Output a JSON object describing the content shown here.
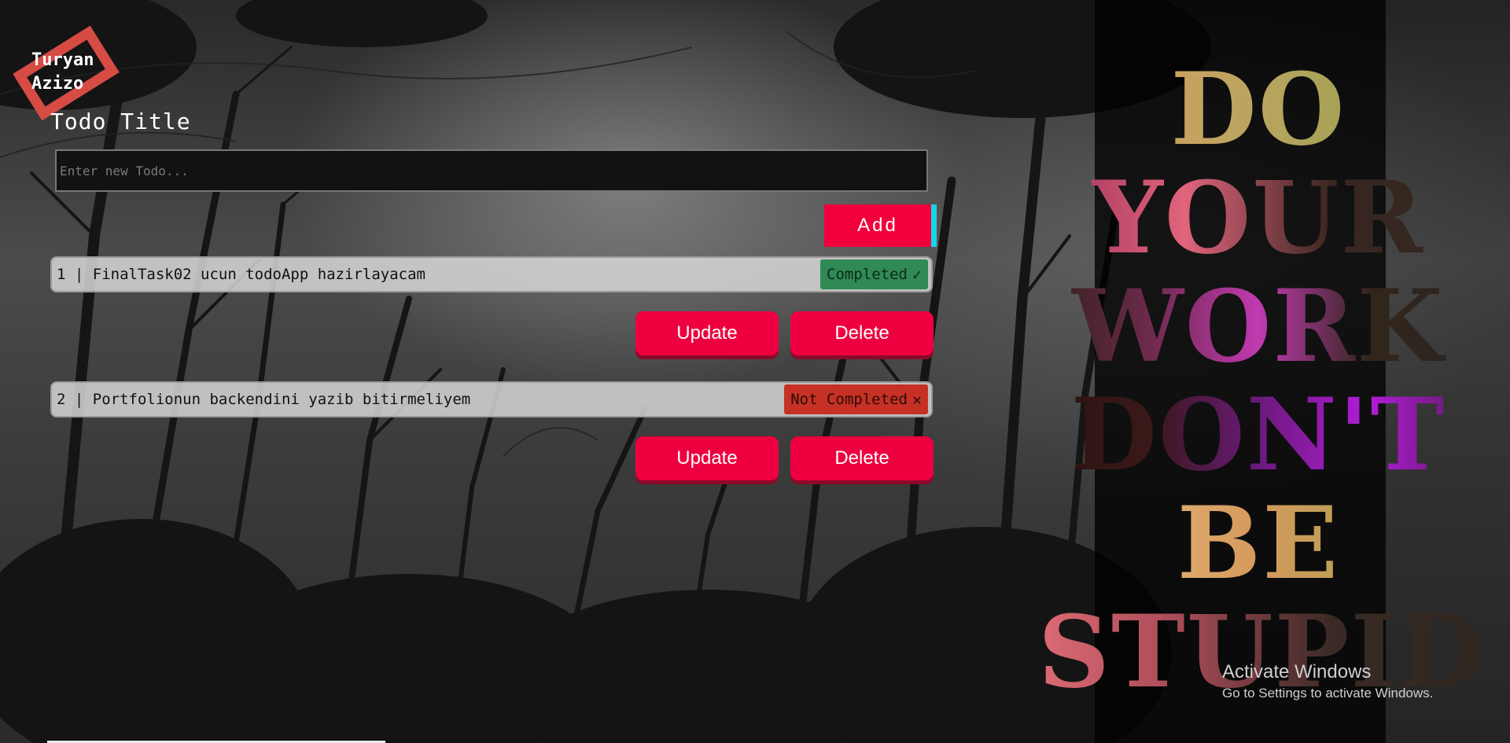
{
  "logo": {
    "line1": "Turyan",
    "line2": "Azizo"
  },
  "form": {
    "title": "Todo Title",
    "input_placeholder": "Enter new Todo...",
    "add_label": "Add"
  },
  "todos": [
    {
      "text": "1 | FinalTask02 ucun todoApp hazirlayacam",
      "status": "Completed",
      "status_glyph": "✓",
      "update_label": "Update",
      "delete_label": "Delete"
    },
    {
      "text": "2 | Portfolionun backendini yazib bitirmeliyem",
      "status": "Not Completed",
      "status_glyph": "✕",
      "update_label": "Update",
      "delete_label": "Delete"
    }
  ],
  "quote": [
    "DO",
    "YOUR",
    "WORK",
    "DON'T",
    "BE",
    "STUPID"
  ],
  "watermark": {
    "title": "Activate Windows",
    "subtitle": "Go to Settings to activate Windows."
  },
  "colors": {
    "accent": "#ee0040",
    "completed": "#2f8a55",
    "not_completed": "#c73125",
    "logo": "#d64b43",
    "add_border": "#13d8e8"
  }
}
